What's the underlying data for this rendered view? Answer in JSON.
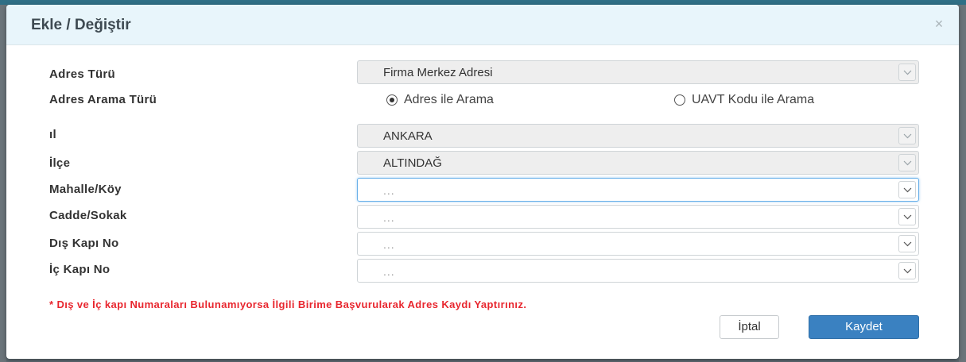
{
  "modal": {
    "title": "Ekle / Değiştir",
    "close_symbol": "×"
  },
  "form": {
    "adres_turu": {
      "label": "Adres Türü",
      "value": "Firma Merkez Adresi"
    },
    "arama_turu": {
      "label": "Adres Arama Türü",
      "options": [
        {
          "label": "Adres ile Arama",
          "selected": true
        },
        {
          "label": "UAVT Kodu ile Arama",
          "selected": false
        }
      ]
    },
    "il": {
      "label": "ıl",
      "value": "ANKARA"
    },
    "ilce": {
      "label": "İlçe",
      "value": "ALTINDAĞ"
    },
    "mahalle": {
      "label": "Mahalle/Köy",
      "placeholder": "..."
    },
    "cadde": {
      "label": "Cadde/Sokak",
      "placeholder": "..."
    },
    "dis_kapi": {
      "label": "Dış Kapı No",
      "placeholder": "..."
    },
    "ic_kapi": {
      "label": "İç Kapı No",
      "placeholder": "..."
    }
  },
  "warning": "* Dış ve İç kapı Numaraları Bulunamıyorsa İlgili Birime Başvurularak Adres Kaydı Yaptırınız.",
  "buttons": {
    "cancel": "İptal",
    "save": "Kaydet"
  },
  "colors": {
    "header_bg": "#e8f5fb",
    "primary": "#3a81c1",
    "warning": "#e8262e",
    "top_bar": "#2f6f86"
  },
  "icons": {
    "close": "close-icon",
    "dropdown": "chevron-down-icon"
  }
}
